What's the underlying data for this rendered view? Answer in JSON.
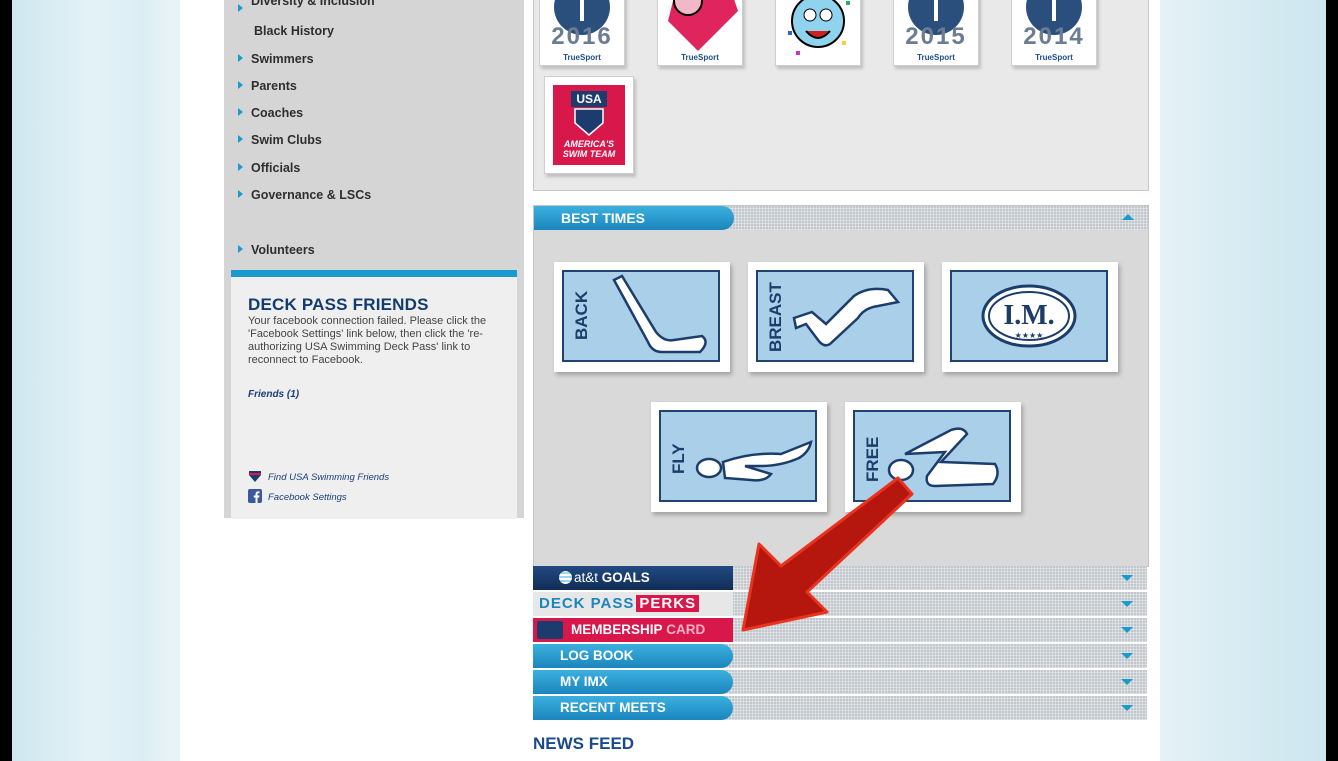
{
  "sidebar": {
    "partial_top": "Diversity & Inclusion",
    "sub_item": "Black History",
    "items": [
      {
        "label": "Swimmers"
      },
      {
        "label": "Parents"
      },
      {
        "label": "Coaches"
      },
      {
        "label": "Swim Clubs"
      },
      {
        "label": "Officials"
      },
      {
        "label": "Governance & LSCs"
      },
      {
        "label": "Volunteers"
      }
    ]
  },
  "friends": {
    "title": "DECK PASS FRIENDS",
    "message": "Your facebook connection failed. Please click the 'Facebook Settings' link below, then click the 're-authorizing USA Swimming Deck Pass' link to reconnect to Facebook.",
    "friends_link": "Friends (1)",
    "find_link": "Find USA Swimming Friends",
    "settings_link": "Facebook Settings"
  },
  "badges": [
    {
      "year": "2016",
      "label": "TrueSport"
    },
    {
      "year": "",
      "label": "TrueSport"
    },
    {
      "year": "",
      "label": ""
    },
    {
      "year": "2015",
      "label": "TrueSport"
    },
    {
      "year": "2014",
      "label": "TrueSport"
    },
    {
      "year": "",
      "label": "",
      "logo_top": "USA",
      "logo_bottom": "AMERICA'S SWIM TEAM"
    }
  ],
  "best_times": {
    "title": "BEST TIMES",
    "strokes": [
      "BACK",
      "BREAST",
      "I.M.",
      "FLY",
      "FREE"
    ]
  },
  "accordion": {
    "goals": {
      "brand": "at&t",
      "label": "GOALS"
    },
    "perks": {
      "part1": "DECK PASS",
      "part2": "PERKS"
    },
    "membership": {
      "part1": "MEMBERSHIP",
      "part2": "CARD"
    },
    "log_book": "LOG BOOK",
    "my_imx": "MY IMX",
    "recent_meets": "RECENT MEETS"
  },
  "news_feed": "NEWS FEED",
  "colors": {
    "accent_blue": "#1a9bd0",
    "navy": "#113c70",
    "red": "#d8174b",
    "arrow_red": "#b5170e"
  }
}
